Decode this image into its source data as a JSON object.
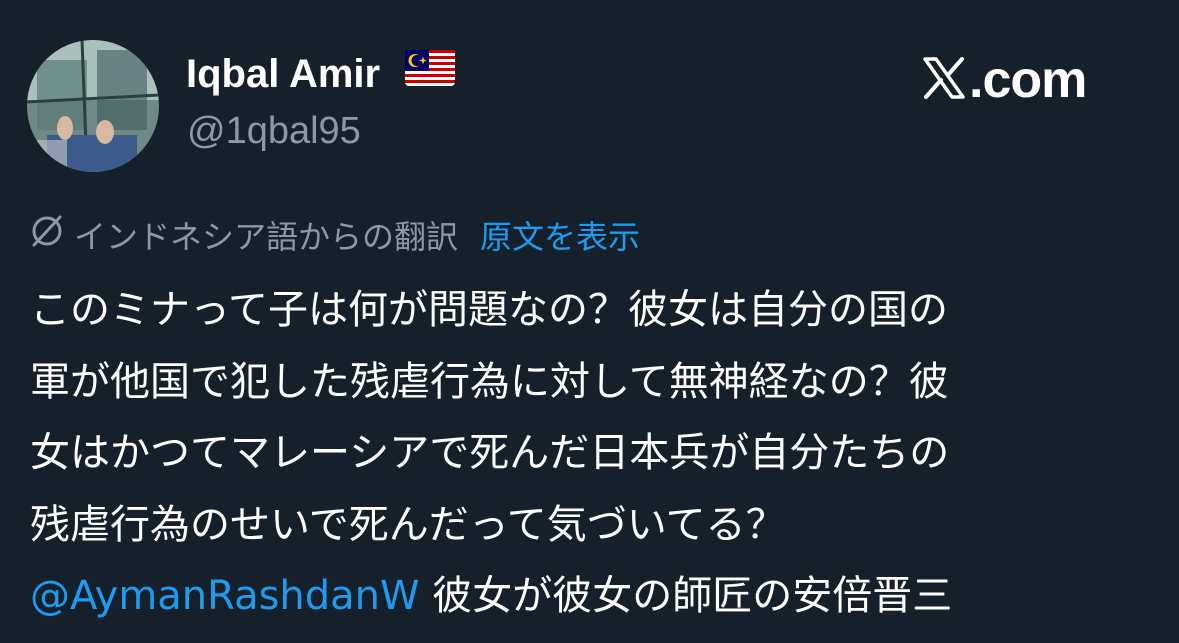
{
  "author": {
    "display_name": "Iqbal Amir",
    "handle": "@1qbal95",
    "flag_icon": "malaysia-flag-icon"
  },
  "brand": {
    "text": ".com",
    "icon": "x-logo-icon"
  },
  "translation": {
    "icon": "translate-icon",
    "label": "インドネシア語からの翻訳",
    "show_original": "原文を表示"
  },
  "tweet": {
    "lines": [
      "このミナって子は何が問題なの？彼女は自分の国の",
      "軍が他国で犯した残虐行為に対して無神経なの？彼",
      "女はかつてマレーシアで死んだ日本兵が自分たちの",
      "残虐行為のせいで死んだって気づいてる？"
    ],
    "mention": "@AymanRashdanW",
    "last_line_rest": " 彼女が彼女の師匠の安倍晋三"
  },
  "colors": {
    "background": "#15202b",
    "text_primary": "#ffffff",
    "text_secondary": "#8b98a5",
    "accent": "#1d9bf0"
  }
}
